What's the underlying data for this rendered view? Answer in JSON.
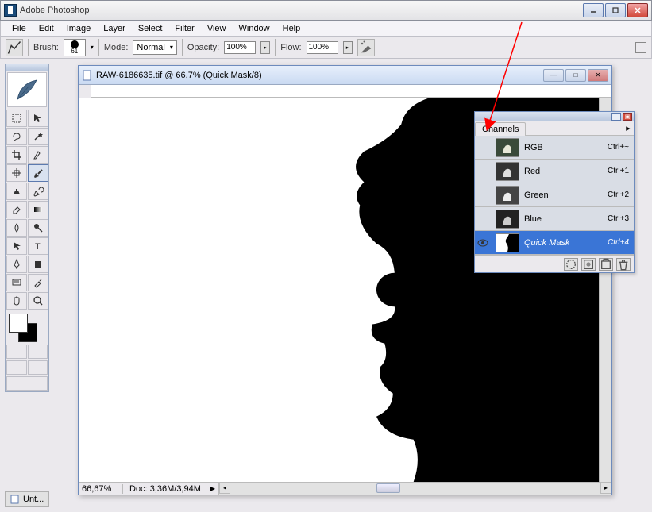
{
  "app": {
    "title": "Adobe Photoshop"
  },
  "menu": {
    "items": [
      "File",
      "Edit",
      "Image",
      "Layer",
      "Select",
      "Filter",
      "View",
      "Window",
      "Help"
    ]
  },
  "options": {
    "brush_label": "Brush:",
    "brush_size": "61",
    "mode_label": "Mode:",
    "mode_value": "Normal",
    "opacity_label": "Opacity:",
    "opacity_value": "100%",
    "flow_label": "Flow:",
    "flow_value": "100%"
  },
  "document": {
    "title": "RAW-6186635.tif @ 66,7% (Quick Mask/8)",
    "zoom": "66,67%",
    "doc_label": "Doc:",
    "doc_size": "3,36M/3,94M"
  },
  "channels": {
    "tab": "Channels",
    "items": [
      {
        "name": "RGB",
        "shortcut": "Ctrl+~",
        "selected": false,
        "eye": false
      },
      {
        "name": "Red",
        "shortcut": "Ctrl+1",
        "selected": false,
        "eye": false
      },
      {
        "name": "Green",
        "shortcut": "Ctrl+2",
        "selected": false,
        "eye": false
      },
      {
        "name": "Blue",
        "shortcut": "Ctrl+3",
        "selected": false,
        "eye": false
      },
      {
        "name": "Quick Mask",
        "shortcut": "Ctrl+4",
        "selected": true,
        "eye": true
      }
    ]
  },
  "taskbar": {
    "tab": "Unt..."
  },
  "tools": [
    "marquee-tool",
    "move-tool",
    "lasso-tool",
    "magic-wand-tool",
    "crop-tool",
    "slice-tool",
    "healing-brush-tool",
    "brush-tool",
    "clone-stamp-tool",
    "history-brush-tool",
    "eraser-tool",
    "gradient-tool",
    "blur-tool",
    "dodge-tool",
    "path-selection-tool",
    "type-tool",
    "pen-tool",
    "shape-tool",
    "notes-tool",
    "eyedropper-tool",
    "hand-tool",
    "zoom-tool"
  ],
  "colors": {
    "accent": "#3a75d6",
    "arrow": "#ff0000"
  }
}
